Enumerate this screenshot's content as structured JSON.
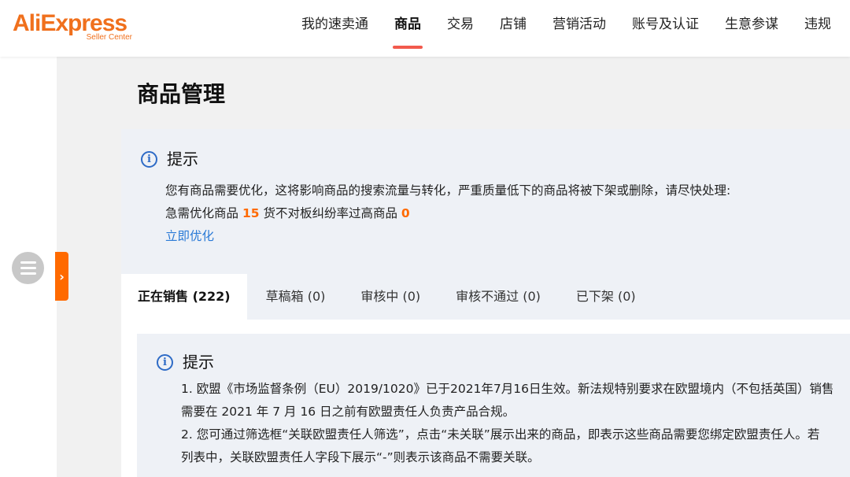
{
  "brand": {
    "name": "AliExpress",
    "sub": "Seller Center",
    "color": "#f0701d"
  },
  "nav": {
    "items": [
      {
        "label": "我的速卖通",
        "active": false
      },
      {
        "label": "商品",
        "active": true
      },
      {
        "label": "交易",
        "active": false
      },
      {
        "label": "店铺",
        "active": false
      },
      {
        "label": "营销活动",
        "active": false
      },
      {
        "label": "账号及认证",
        "active": false
      },
      {
        "label": "生意参谋",
        "active": false
      },
      {
        "label": "违规",
        "active": false
      }
    ]
  },
  "sidebar": {
    "toggle_icon": "menu-icon",
    "expand_glyph": "›"
  },
  "page": {
    "title": "商品管理"
  },
  "notice1": {
    "title": "提示",
    "line1": "您有商品需要优化，这将影响商品的搜索流量与转化，严重质量低下的商品将被下架或删除，请尽快处理:",
    "label_urgent": "急需优化商品",
    "count_urgent": "15",
    "label_mismatch": "货不对板纠纷率过高商品",
    "count_mismatch": "0",
    "link": "立即优化"
  },
  "tabs": [
    {
      "label": "正在销售 (222)",
      "active": true
    },
    {
      "label": "草稿箱 (0)",
      "active": false
    },
    {
      "label": "审核中 (0)",
      "active": false
    },
    {
      "label": "审核不通过 (0)",
      "active": false
    },
    {
      "label": "已下架 (0)",
      "active": false
    }
  ],
  "notice2": {
    "title": "提示",
    "lines": [
      "1. 欧盟《市场监督条例（EU）2019/1020》已于2021年7月16日生效。新法规特别要求在欧盟境内（不包括英国）销售",
      "需要在 2021 年 7 月 16 日之前有欧盟责任人负责产品合规。",
      "2. 您可通过筛选框“关联欧盟责任人筛选”，点击“未关联”展示出来的商品，即表示这些商品需要您绑定欧盟责任人。若",
      "列表中，关联欧盟责任人字段下展示“-”则表示该商品不需要关联。"
    ]
  },
  "colors": {
    "accent": "#ff6a00",
    "link": "#2a7ad6",
    "info": "#2e6bc6",
    "nav_underline": "#f25a4d"
  }
}
